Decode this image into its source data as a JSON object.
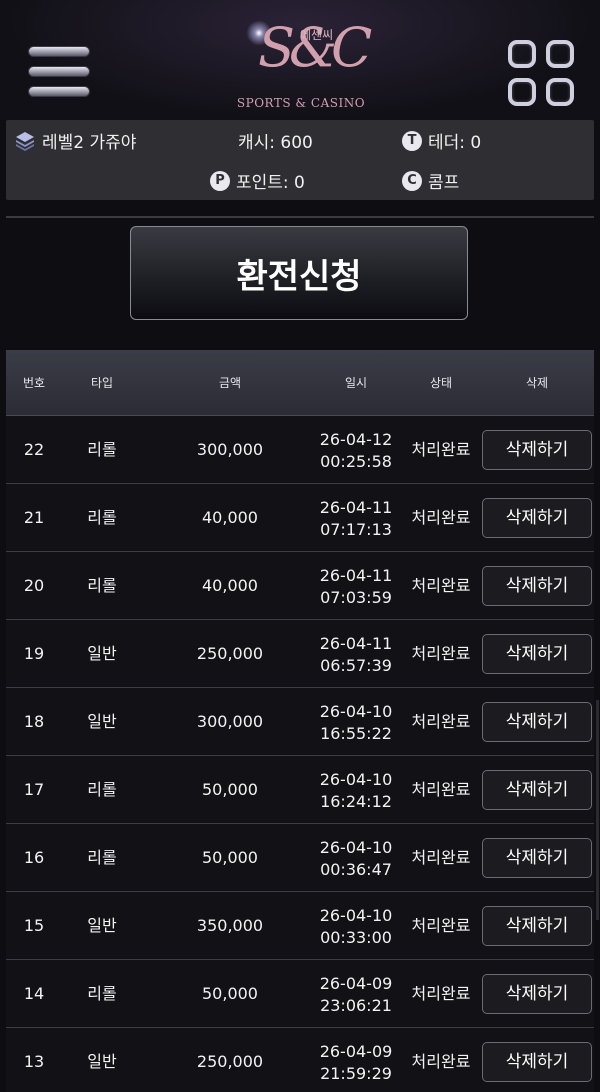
{
  "header": {
    "logo_text": "S&C",
    "logo_korean": "에센씨",
    "logo_subtitle": "SPORTS & CASINO"
  },
  "info": {
    "level": "레벨2 가쥬야",
    "cash": "캐시: 600",
    "tether": "테더: 0",
    "points": "포인트: 0",
    "comp": "콤프"
  },
  "icons": {
    "menu": "hamburger-menu-icon",
    "grid": "grid-menu-icon",
    "level": "level-layers-icon",
    "tether": "tether-t-icon",
    "points": "points-p-icon",
    "comp": "comp-c-icon"
  },
  "action": {
    "label": "환전신청"
  },
  "table": {
    "headers": [
      "번호",
      "타입",
      "금액",
      "일시",
      "상태",
      "삭제"
    ],
    "rows": [
      {
        "no": "22",
        "type": "리롤",
        "amount": "300,000",
        "date": "26-04-12",
        "time": "00:25:58",
        "status": "처리완료",
        "delete": "삭제하기"
      },
      {
        "no": "21",
        "type": "리롤",
        "amount": "40,000",
        "date": "26-04-11",
        "time": "07:17:13",
        "status": "처리완료",
        "delete": "삭제하기"
      },
      {
        "no": "20",
        "type": "리롤",
        "amount": "40,000",
        "date": "26-04-11",
        "time": "07:03:59",
        "status": "처리완료",
        "delete": "삭제하기"
      },
      {
        "no": "19",
        "type": "일반",
        "amount": "250,000",
        "date": "26-04-11",
        "time": "06:57:39",
        "status": "처리완료",
        "delete": "삭제하기"
      },
      {
        "no": "18",
        "type": "일반",
        "amount": "300,000",
        "date": "26-04-10",
        "time": "16:55:22",
        "status": "처리완료",
        "delete": "삭제하기"
      },
      {
        "no": "17",
        "type": "리롤",
        "amount": "50,000",
        "date": "26-04-10",
        "time": "16:24:12",
        "status": "처리완료",
        "delete": "삭제하기"
      },
      {
        "no": "16",
        "type": "리롤",
        "amount": "50,000",
        "date": "26-04-10",
        "time": "00:36:47",
        "status": "처리완료",
        "delete": "삭제하기"
      },
      {
        "no": "15",
        "type": "일반",
        "amount": "350,000",
        "date": "26-04-10",
        "time": "00:33:00",
        "status": "처리완료",
        "delete": "삭제하기"
      },
      {
        "no": "14",
        "type": "리롤",
        "amount": "50,000",
        "date": "26-04-09",
        "time": "23:06:21",
        "status": "처리완료",
        "delete": "삭제하기"
      },
      {
        "no": "13",
        "type": "일반",
        "amount": "250,000",
        "date": "26-04-09",
        "time": "21:59:29",
        "status": "처리완료",
        "delete": "삭제하기"
      }
    ]
  },
  "colors": {
    "background": "#0e0d12",
    "info_bar": "#2e2e33",
    "logo_pink": "#d2a0ad",
    "table_header": "#32333d"
  }
}
